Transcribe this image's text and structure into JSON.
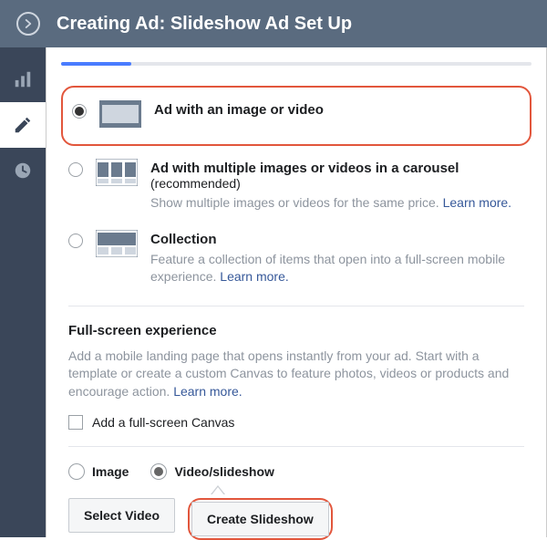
{
  "header": {
    "title": "Creating Ad: Slideshow Ad Set Up"
  },
  "formats": {
    "single": {
      "title": "Ad with an image or video"
    },
    "carousel": {
      "title": "Ad with multiple images or videos in a carousel",
      "recommended": "(recommended)",
      "desc": "Show multiple images or videos for the same price. ",
      "learn": "Learn more."
    },
    "collection": {
      "title": "Collection",
      "desc": "Feature a collection of items that open into a full-screen mobile experience. ",
      "learn": "Learn more."
    }
  },
  "fullscreen": {
    "title": "Full-screen experience",
    "desc": "Add a mobile landing page that opens instantly from your ad. Start with a template or create a custom Canvas to feature photos, videos or products and encourage action. ",
    "learn": "Learn more.",
    "checkbox_label": "Add a full-screen Canvas"
  },
  "media": {
    "image_label": "Image",
    "video_label": "Video/slideshow",
    "select_video_btn": "Select Video",
    "create_slideshow_btn": "Create Slideshow"
  }
}
